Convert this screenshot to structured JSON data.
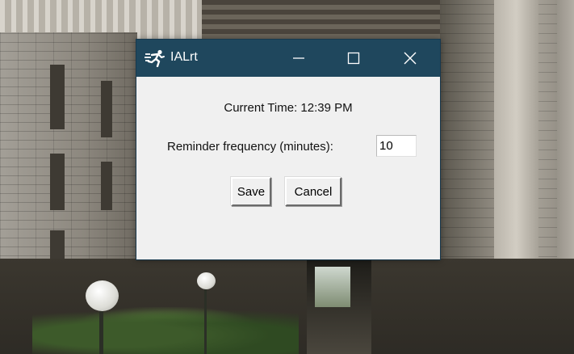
{
  "window": {
    "title": "IALrt",
    "icon": "running-person-icon",
    "controls": [
      "minimize-icon",
      "maximize-icon",
      "close-icon"
    ],
    "titlebar_color": "#1f475d"
  },
  "content": {
    "current_time": "Current Time: 12:39 PM",
    "frequency_label": "Reminder frequency (minutes):",
    "frequency_value": "10"
  },
  "buttons": {
    "save": "Save",
    "cancel": "Cancel"
  }
}
